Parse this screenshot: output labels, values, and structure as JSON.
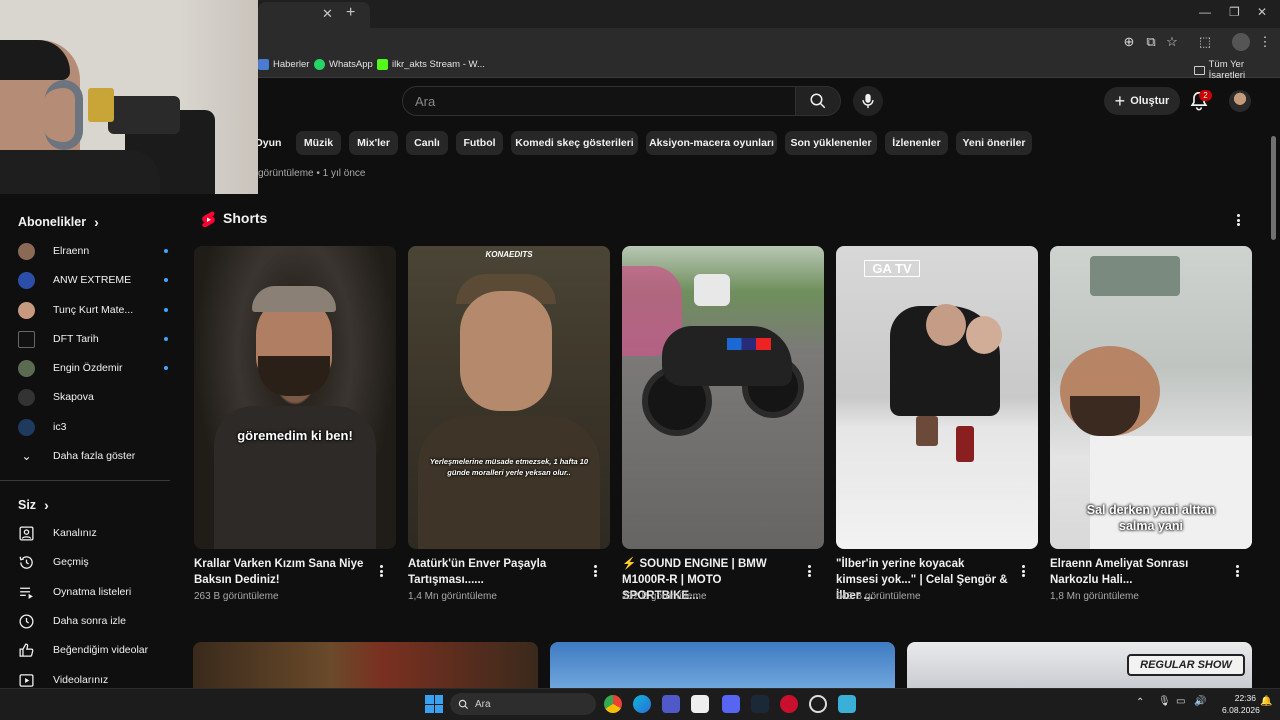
{
  "browser": {
    "bookmarks": [
      {
        "label": "Haberler",
        "color": "#4a7bd0"
      },
      {
        "label": "WhatsApp",
        "color": "#25d366"
      },
      {
        "label": "ilkr_akts Stream - W...",
        "color": "#53fc18"
      }
    ],
    "all_bookmarks": "Tüm Yer İşaretleri"
  },
  "header": {
    "search_placeholder": "Ara",
    "create_label": "Oluştur",
    "notification_count": "2"
  },
  "chips": [
    "Oyun",
    "Müzik",
    "Mix'ler",
    "Canlı",
    "Futbol",
    "Komedi skeç gösterileri",
    "Aksiyon-macera oyunları",
    "Son yüklenenler",
    "İzlenenler",
    "Yeni öneriler"
  ],
  "prev_video_meta": "görüntüleme • 1 yıl önce",
  "sidebar": {
    "subscriptions_title": "Abonelikler",
    "subscriptions": [
      {
        "name": "Elraenn",
        "new": true
      },
      {
        "name": "ANW EXTREME",
        "new": true
      },
      {
        "name": "Tunç Kurt Mate...",
        "new": true
      },
      {
        "name": "DFT Tarih",
        "new": true
      },
      {
        "name": "Engin Özdemir",
        "new": true
      },
      {
        "name": "Skapova",
        "new": false
      },
      {
        "name": "ic3",
        "new": false
      }
    ],
    "show_more": "Daha fazla göster",
    "you_title": "Siz",
    "you_items": [
      {
        "label": "Kanalınız",
        "icon": "channel-icon"
      },
      {
        "label": "Geçmiş",
        "icon": "history-icon"
      },
      {
        "label": "Oynatma listeleri",
        "icon": "playlist-icon"
      },
      {
        "label": "Daha sonra izle",
        "icon": "clock-icon"
      },
      {
        "label": "Beğendiğim videolar",
        "icon": "thumbs-up-icon"
      },
      {
        "label": "Videolarınız",
        "icon": "video-icon"
      }
    ]
  },
  "shorts": {
    "title": "Shorts",
    "items": [
      {
        "title": "Krallar Varken Kızım Sana Niye Baksın Dediniz!",
        "views": "263 B görüntüleme",
        "overlay": "göremedim ki ben!"
      },
      {
        "title": "Atatürk'ün Enver Paşayla Tartışması......",
        "views": "1,4 Mn görüntüleme",
        "overlay": "Yerleşmelerine müsade etmezsek, 1 hafta 10 günde moralleri yerle yeksan olur..",
        "badge": "KONAEDITS"
      },
      {
        "title": "⚡ SOUND ENGINE | BMW M1000R-R | MOTO SPORTBIKE...",
        "views": "232 B görüntüleme",
        "overlay": ""
      },
      {
        "title": "\"İlber'in yerine koyacak kimsesi yok...\" | Celal Şengör & İlber ...",
        "views": "943 B görüntüleme",
        "overlay": "",
        "badge": "GA TV"
      },
      {
        "title": "Elraenn Ameliyat Sonrası Narkozlu Hali...",
        "views": "1,8 Mn görüntüleme",
        "overlay": "Sal derken yani alttan salma yani"
      }
    ]
  },
  "bottom_badge": "REGULAR SHOW",
  "taskbar": {
    "search_placeholder": "Ara",
    "time": "22:36",
    "date": "6.08.2026"
  }
}
